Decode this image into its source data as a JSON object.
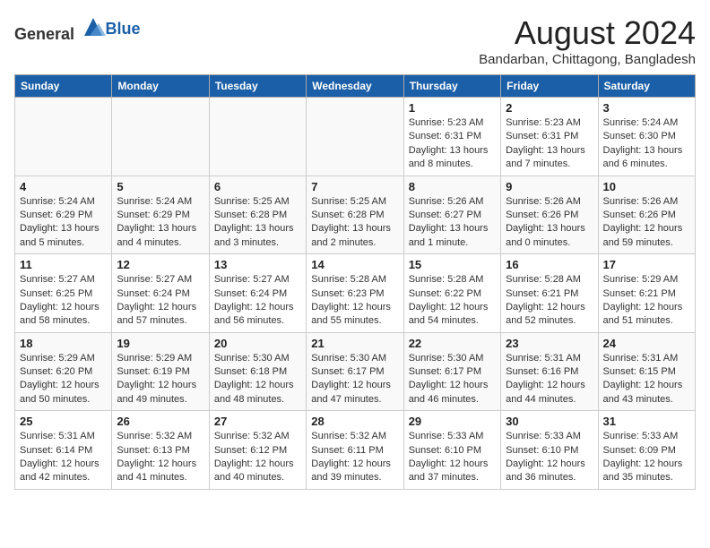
{
  "header": {
    "logo_general": "General",
    "logo_blue": "Blue",
    "month_title": "August 2024",
    "location": "Bandarban, Chittagong, Bangladesh"
  },
  "weekdays": [
    "Sunday",
    "Monday",
    "Tuesday",
    "Wednesday",
    "Thursday",
    "Friday",
    "Saturday"
  ],
  "weeks": [
    [
      {
        "day": "",
        "info": ""
      },
      {
        "day": "",
        "info": ""
      },
      {
        "day": "",
        "info": ""
      },
      {
        "day": "",
        "info": ""
      },
      {
        "day": "1",
        "info": "Sunrise: 5:23 AM\nSunset: 6:31 PM\nDaylight: 13 hours\nand 8 minutes."
      },
      {
        "day": "2",
        "info": "Sunrise: 5:23 AM\nSunset: 6:31 PM\nDaylight: 13 hours\nand 7 minutes."
      },
      {
        "day": "3",
        "info": "Sunrise: 5:24 AM\nSunset: 6:30 PM\nDaylight: 13 hours\nand 6 minutes."
      }
    ],
    [
      {
        "day": "4",
        "info": "Sunrise: 5:24 AM\nSunset: 6:29 PM\nDaylight: 13 hours\nand 5 minutes."
      },
      {
        "day": "5",
        "info": "Sunrise: 5:24 AM\nSunset: 6:29 PM\nDaylight: 13 hours\nand 4 minutes."
      },
      {
        "day": "6",
        "info": "Sunrise: 5:25 AM\nSunset: 6:28 PM\nDaylight: 13 hours\nand 3 minutes."
      },
      {
        "day": "7",
        "info": "Sunrise: 5:25 AM\nSunset: 6:28 PM\nDaylight: 13 hours\nand 2 minutes."
      },
      {
        "day": "8",
        "info": "Sunrise: 5:26 AM\nSunset: 6:27 PM\nDaylight: 13 hours\nand 1 minute."
      },
      {
        "day": "9",
        "info": "Sunrise: 5:26 AM\nSunset: 6:26 PM\nDaylight: 13 hours\nand 0 minutes."
      },
      {
        "day": "10",
        "info": "Sunrise: 5:26 AM\nSunset: 6:26 PM\nDaylight: 12 hours\nand 59 minutes."
      }
    ],
    [
      {
        "day": "11",
        "info": "Sunrise: 5:27 AM\nSunset: 6:25 PM\nDaylight: 12 hours\nand 58 minutes."
      },
      {
        "day": "12",
        "info": "Sunrise: 5:27 AM\nSunset: 6:24 PM\nDaylight: 12 hours\nand 57 minutes."
      },
      {
        "day": "13",
        "info": "Sunrise: 5:27 AM\nSunset: 6:24 PM\nDaylight: 12 hours\nand 56 minutes."
      },
      {
        "day": "14",
        "info": "Sunrise: 5:28 AM\nSunset: 6:23 PM\nDaylight: 12 hours\nand 55 minutes."
      },
      {
        "day": "15",
        "info": "Sunrise: 5:28 AM\nSunset: 6:22 PM\nDaylight: 12 hours\nand 54 minutes."
      },
      {
        "day": "16",
        "info": "Sunrise: 5:28 AM\nSunset: 6:21 PM\nDaylight: 12 hours\nand 52 minutes."
      },
      {
        "day": "17",
        "info": "Sunrise: 5:29 AM\nSunset: 6:21 PM\nDaylight: 12 hours\nand 51 minutes."
      }
    ],
    [
      {
        "day": "18",
        "info": "Sunrise: 5:29 AM\nSunset: 6:20 PM\nDaylight: 12 hours\nand 50 minutes."
      },
      {
        "day": "19",
        "info": "Sunrise: 5:29 AM\nSunset: 6:19 PM\nDaylight: 12 hours\nand 49 minutes."
      },
      {
        "day": "20",
        "info": "Sunrise: 5:30 AM\nSunset: 6:18 PM\nDaylight: 12 hours\nand 48 minutes."
      },
      {
        "day": "21",
        "info": "Sunrise: 5:30 AM\nSunset: 6:17 PM\nDaylight: 12 hours\nand 47 minutes."
      },
      {
        "day": "22",
        "info": "Sunrise: 5:30 AM\nSunset: 6:17 PM\nDaylight: 12 hours\nand 46 minutes."
      },
      {
        "day": "23",
        "info": "Sunrise: 5:31 AM\nSunset: 6:16 PM\nDaylight: 12 hours\nand 44 minutes."
      },
      {
        "day": "24",
        "info": "Sunrise: 5:31 AM\nSunset: 6:15 PM\nDaylight: 12 hours\nand 43 minutes."
      }
    ],
    [
      {
        "day": "25",
        "info": "Sunrise: 5:31 AM\nSunset: 6:14 PM\nDaylight: 12 hours\nand 42 minutes."
      },
      {
        "day": "26",
        "info": "Sunrise: 5:32 AM\nSunset: 6:13 PM\nDaylight: 12 hours\nand 41 minutes."
      },
      {
        "day": "27",
        "info": "Sunrise: 5:32 AM\nSunset: 6:12 PM\nDaylight: 12 hours\nand 40 minutes."
      },
      {
        "day": "28",
        "info": "Sunrise: 5:32 AM\nSunset: 6:11 PM\nDaylight: 12 hours\nand 39 minutes."
      },
      {
        "day": "29",
        "info": "Sunrise: 5:33 AM\nSunset: 6:10 PM\nDaylight: 12 hours\nand 37 minutes."
      },
      {
        "day": "30",
        "info": "Sunrise: 5:33 AM\nSunset: 6:10 PM\nDaylight: 12 hours\nand 36 minutes."
      },
      {
        "day": "31",
        "info": "Sunrise: 5:33 AM\nSunset: 6:09 PM\nDaylight: 12 hours\nand 35 minutes."
      }
    ]
  ]
}
